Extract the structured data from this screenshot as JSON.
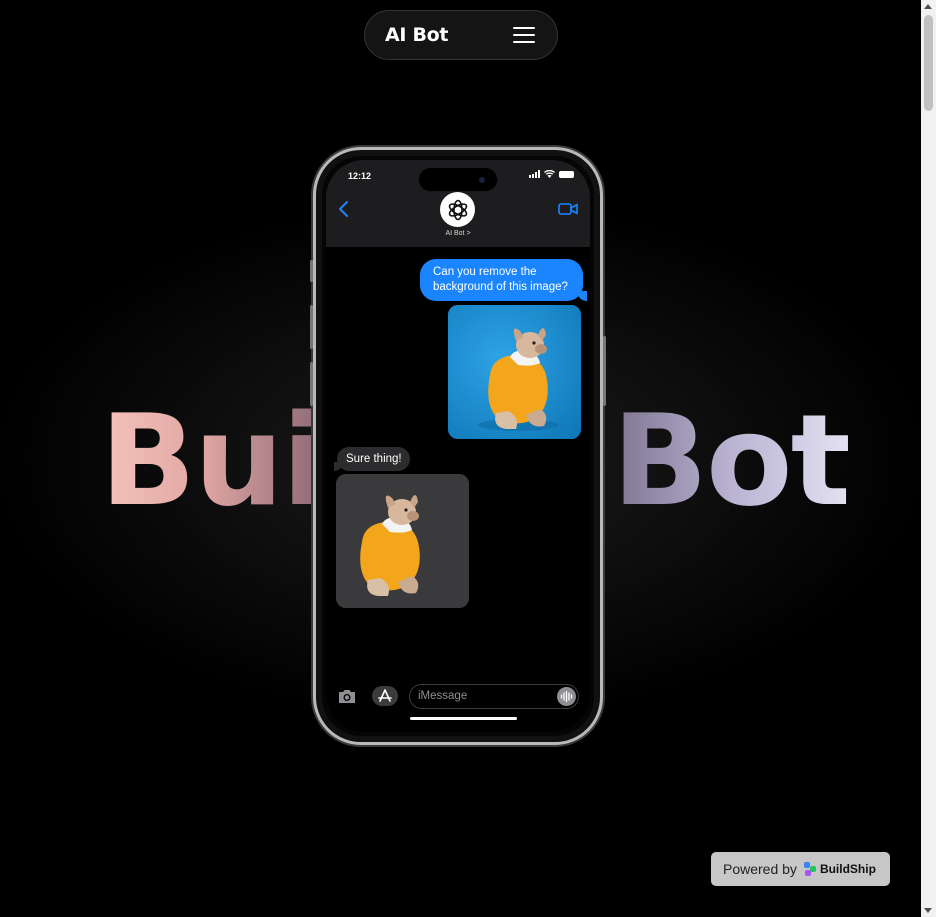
{
  "nav": {
    "title": "AI Bot"
  },
  "hero": {
    "left_text": "Bui",
    "right_text": "Bot"
  },
  "phone": {
    "status_time": "12:12",
    "contact_name": "AI Bot >",
    "messages": {
      "outgoing_text": "Can you remove the background of this image?",
      "incoming_text": "Sure thing!"
    },
    "input_placeholder": "iMessage"
  },
  "footer": {
    "powered_by": "Powered by",
    "brand": "BuildShip"
  },
  "colors": {
    "accent": "#1a85ff",
    "bubble_in": "#2c2c2e",
    "photo_bg": "#1a8fd3"
  }
}
